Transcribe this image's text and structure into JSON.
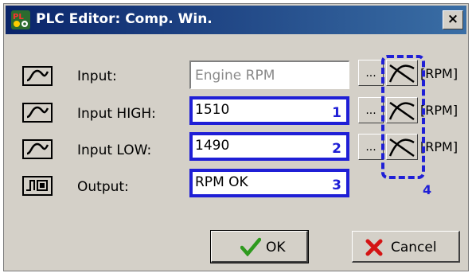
{
  "window": {
    "title": "PLC Editor: Comp. Win.",
    "close_label": "×"
  },
  "rows": [
    {
      "label": "Input:",
      "value": "Engine RPM",
      "marker": "",
      "unit": "[RPM]",
      "icon": "analog-wave-icon",
      "browse_label": "..."
    },
    {
      "label": "Input HIGH:",
      "value": "1510",
      "marker": "1",
      "unit": "[RPM]",
      "icon": "analog-wave-icon",
      "browse_label": "..."
    },
    {
      "label": "Input LOW:",
      "value": "1490",
      "marker": "2",
      "unit": "[RPM]",
      "icon": "analog-wave-icon",
      "browse_label": "..."
    },
    {
      "label": "Output:",
      "value": "RPM OK",
      "marker": "3",
      "icon": "digital-pulse-icon"
    }
  ],
  "annotation": {
    "group_marker": "4"
  },
  "buttons": {
    "ok_label": "OK",
    "cancel_label": "Cancel"
  },
  "colors": {
    "titlebar_start": "#0a246a",
    "titlebar_end": "#3a6ea5",
    "highlight_blue": "#1f1fd6",
    "dialog_face": "#d4d0c8"
  }
}
